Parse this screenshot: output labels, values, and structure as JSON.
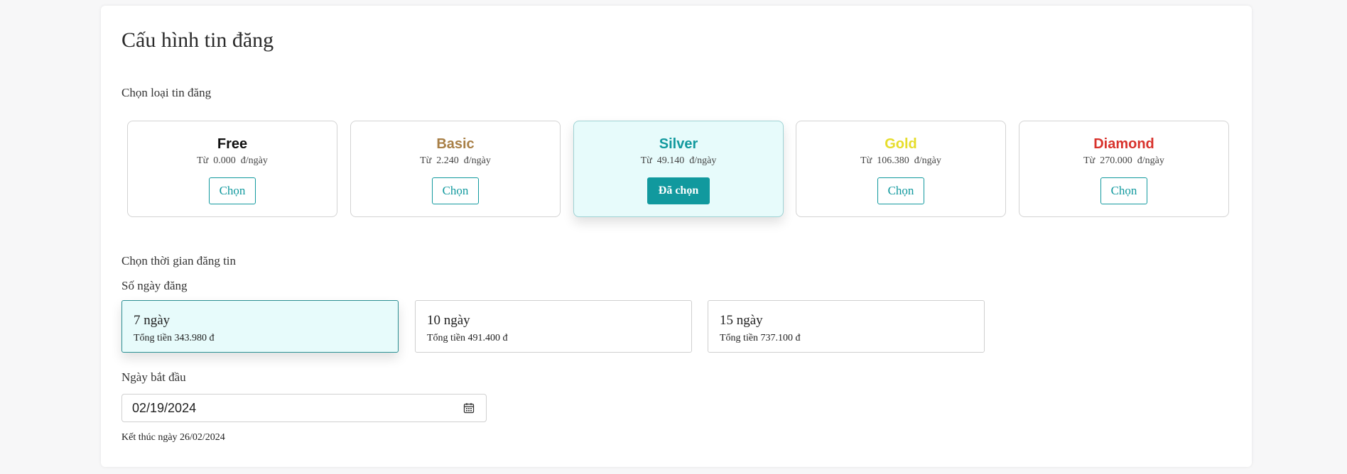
{
  "page": {
    "title": "Cấu hình tin đăng"
  },
  "post_type": {
    "label": "Chọn loại tin đăng",
    "price_prefix": "Từ",
    "items": [
      {
        "name": "Free",
        "price": "0.000",
        "unit": "đ/ngày",
        "button": "Chọn",
        "color": "#111111",
        "selected": false
      },
      {
        "name": "Basic",
        "price": "2.240",
        "unit": "đ/ngày",
        "button": "Chọn",
        "color": "#a87f46",
        "selected": false
      },
      {
        "name": "Silver",
        "price": "49.140",
        "unit": "đ/ngày",
        "button": "Đã chọn",
        "color": "#11999e",
        "selected": true
      },
      {
        "name": "Gold",
        "price": "106.380",
        "unit": "đ/ngày",
        "button": "Chọn",
        "color": "#e6dd2b",
        "selected": false
      },
      {
        "name": "Diamond",
        "price": "270.000",
        "unit": "đ/ngày",
        "button": "Chọn",
        "color": "#d8322c",
        "selected": false
      }
    ]
  },
  "duration": {
    "label": "Chọn thời gian đăng tin",
    "days_label": "Số ngày đăng",
    "options": [
      {
        "label": "7 ngày",
        "total": "Tổng tiền 343.980 đ",
        "selected": true
      },
      {
        "label": "10 ngày",
        "total": "Tổng tiền 491.400 đ",
        "selected": false
      },
      {
        "label": "15 ngày",
        "total": "Tổng tiền 737.100 đ",
        "selected": false
      }
    ]
  },
  "start_date": {
    "label": "Ngày bắt đầu",
    "value": "02/19/2024",
    "icon": "calendar-icon"
  },
  "end_date": {
    "text": "Kết thúc ngày 26/02/2024"
  }
}
